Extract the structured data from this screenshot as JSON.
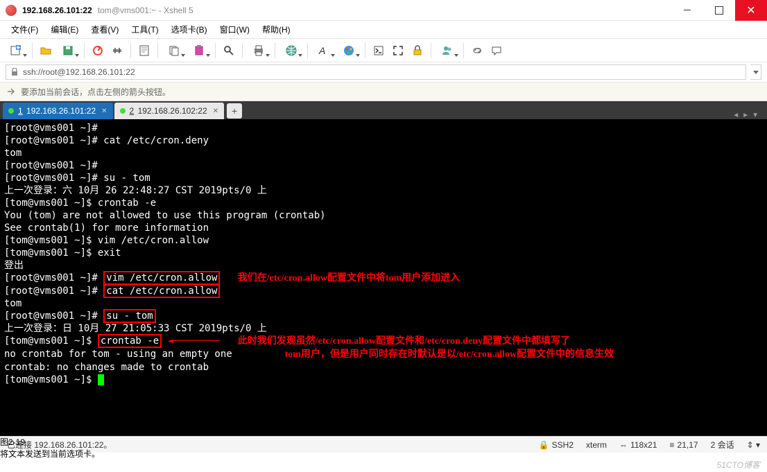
{
  "title": {
    "ip": "192.168.26.101:22",
    "rest": "tom@vms001:~ - Xshell 5"
  },
  "menu": {
    "file": "文件(F)",
    "edit": "编辑(E)",
    "view": "查看(V)",
    "tools": "工具(T)",
    "tabs": "选项卡(B)",
    "window": "窗口(W)",
    "help": "帮助(H)"
  },
  "address": "ssh://root@192.168.26.101:22",
  "hint": "要添加当前会话，点击左侧的箭头按钮。",
  "tabs": [
    {
      "num": "1",
      "label": "192.168.26.101:22",
      "active": true
    },
    {
      "num": "2",
      "label": "192.168.26.102:22",
      "active": false
    }
  ],
  "terminal": {
    "l01": "[root@vms001 ~]#",
    "l02": "[root@vms001 ~]# cat /etc/cron.deny",
    "l03": "tom",
    "l04": "[root@vms001 ~]#",
    "l05": "[root@vms001 ~]# su - tom",
    "l06": "上一次登录：六 10月 26 22:48:27 CST 2019pts/0 上",
    "l07": "[tom@vms001 ~]$ crontab -e",
    "l08": "You (tom) are not allowed to use this program (crontab)",
    "l09": "See crontab(1) for more information",
    "l10": "[tom@vms001 ~]$ vim /etc/cron.allow",
    "l11": "[tom@vms001 ~]$ exit",
    "l12": "登出",
    "l13a": "[root@vms001 ~]# ",
    "l13b": "vim /etc/cron.allow",
    "l14a": "[root@vms001 ~]# ",
    "l14b": "cat /etc/cron.allow",
    "ann1": "我们在/etc/cron.allow配置文件中将tom用户添加进入",
    "l15": "tom",
    "l16a": "[root@vms001 ~]# ",
    "l16b": "su - tom",
    "l17": "上一次登录：日 10月 27 21:05:33 CST 2019pts/0 上",
    "l18a": "[tom@vms001 ~]$ ",
    "l18b": "crontab -e",
    "ann2a": "此时我们发现虽然/etc/cron.allow配置文件和/etc/cron.deny配置文件中都填写了",
    "l19": "no crontab for tom - using an empty one",
    "ann2b": "tom用户，但是用户同时存在时默认是以/etc/cron.allow配置文件中的信息生效",
    "l20": "crontab: no changes made to crontab",
    "l21": "[tom@vms001 ~]$ ",
    "figlabel": "图2-19",
    "overlay_note": "将文本发送到当前选项卡。"
  },
  "status": {
    "left": "已连接 192.168.26.101:22。",
    "ssh": "SSH2",
    "term": "xterm",
    "size": "118x21",
    "pos": "21,17",
    "sessions": "2 会话"
  },
  "watermark": "51CTO博客"
}
